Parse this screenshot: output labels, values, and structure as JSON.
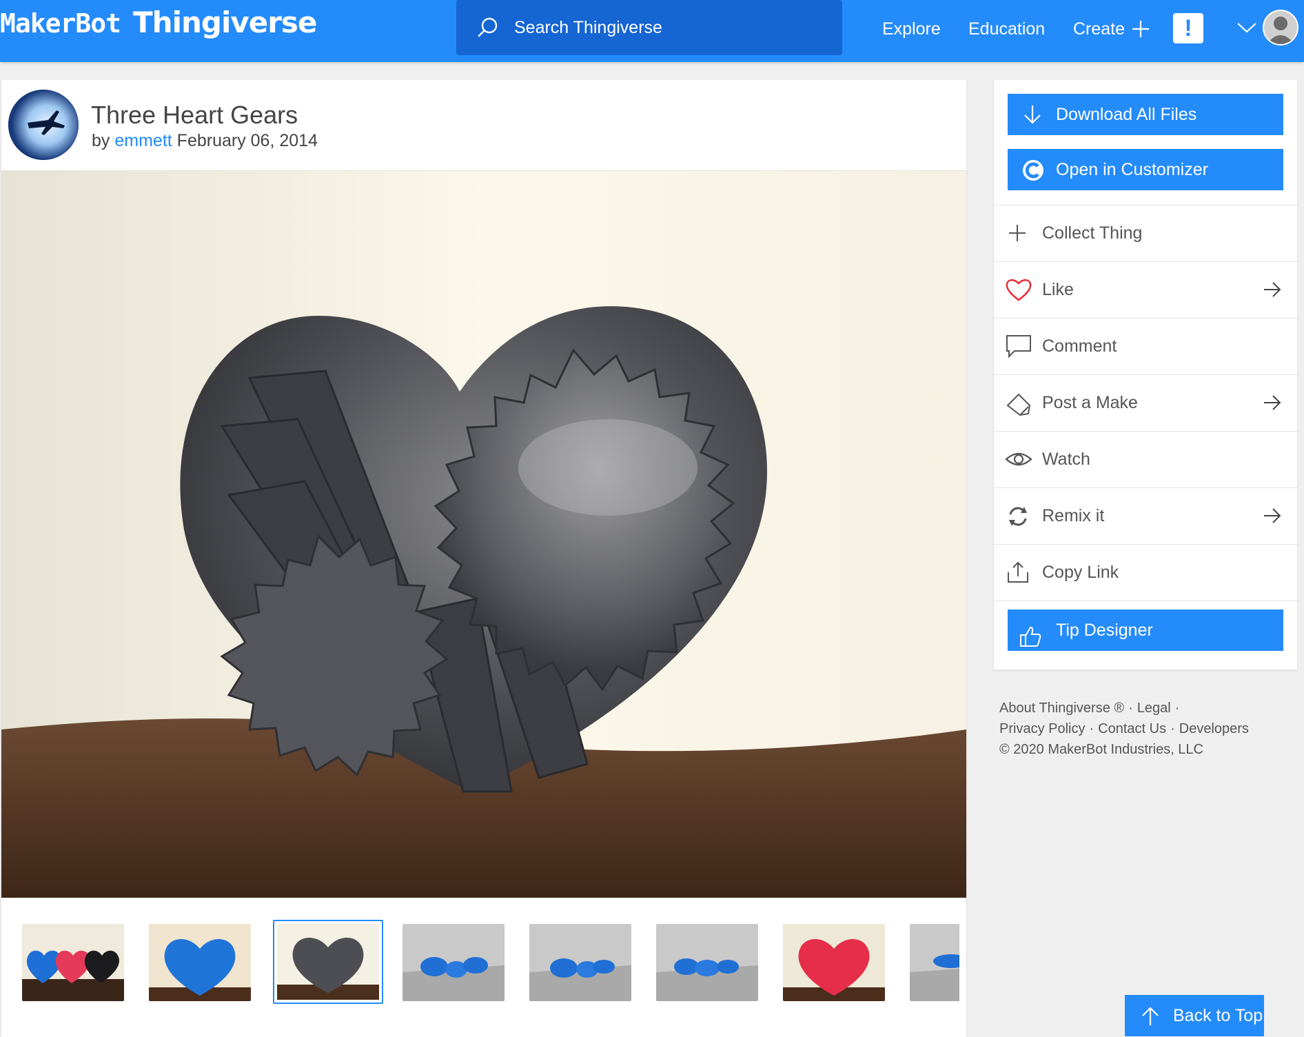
{
  "header": {
    "logo_maker": "MakerBot",
    "logo_thingiverse": "Thingiverse",
    "search_placeholder": "Search Thingiverse",
    "nav": {
      "explore": "Explore",
      "education": "Education",
      "create": "Create"
    },
    "alert_label": "!"
  },
  "thing": {
    "title": "Three Heart Gears",
    "by": "by",
    "author": "emmett",
    "date": "February 06, 2014"
  },
  "thumbnails": [
    {
      "name": "three-hearts-colored"
    },
    {
      "name": "blue-heart"
    },
    {
      "name": "gray-heart",
      "active": true
    },
    {
      "name": "blue-gears-render-1"
    },
    {
      "name": "blue-gears-render-2"
    },
    {
      "name": "blue-gears-render-3"
    },
    {
      "name": "red-heart"
    },
    {
      "name": "blue-gear-partial"
    }
  ],
  "sidebar": {
    "download_all": "Download All Files",
    "open_customizer": "Open in Customizer",
    "collect": "Collect Thing",
    "like": "Like",
    "comment": "Comment",
    "post_make": "Post a Make",
    "watch": "Watch",
    "remix": "Remix it",
    "copy_link": "Copy Link",
    "tip_designer": "Tip Designer"
  },
  "footer": {
    "about": "About Thingiverse ®",
    "legal": "Legal",
    "privacy": "Privacy Policy",
    "contact": "Contact Us",
    "developers": "Developers",
    "copyright": "©  2020 MakerBot Industries, LLC"
  },
  "back_to_top": "Back to Top",
  "colors": {
    "brand_blue": "#248bfb",
    "search_bg": "#1565d3",
    "like_red": "#e8262e"
  }
}
